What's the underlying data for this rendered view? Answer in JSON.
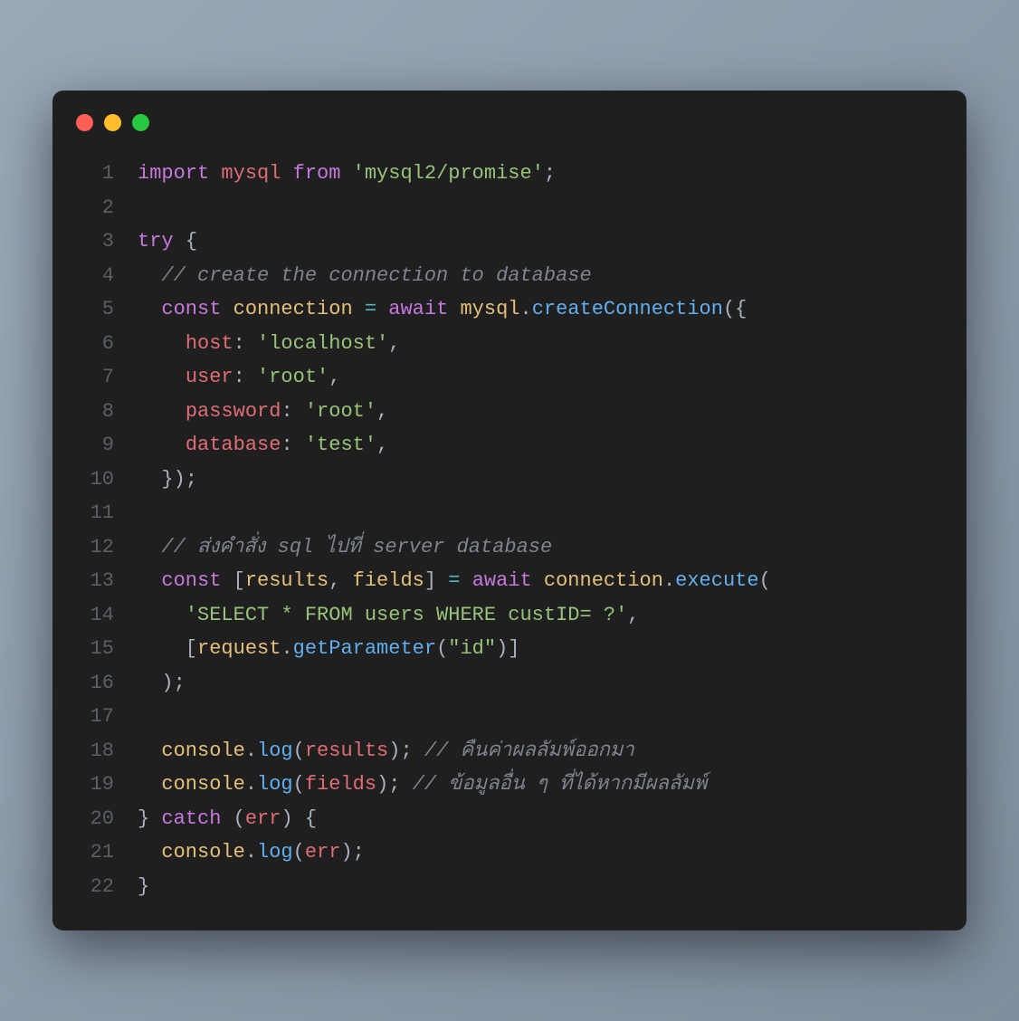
{
  "window": {
    "traffic_lights": {
      "red": "#ff5f56",
      "yellow": "#ffbd2e",
      "green": "#27c93f"
    }
  },
  "code": {
    "lines": [
      {
        "n": "1",
        "tokens": [
          {
            "t": "import",
            "c": "kw"
          },
          {
            "t": " ",
            "c": "txt"
          },
          {
            "t": "mysql",
            "c": "ident"
          },
          {
            "t": " ",
            "c": "txt"
          },
          {
            "t": "from",
            "c": "kw"
          },
          {
            "t": " ",
            "c": "txt"
          },
          {
            "t": "'mysql2/promise'",
            "c": "str"
          },
          {
            "t": ";",
            "c": "punct"
          }
        ]
      },
      {
        "n": "2",
        "tokens": []
      },
      {
        "n": "3",
        "tokens": [
          {
            "t": "try",
            "c": "kw"
          },
          {
            "t": " ",
            "c": "txt"
          },
          {
            "t": "{",
            "c": "punct"
          }
        ]
      },
      {
        "n": "4",
        "tokens": [
          {
            "t": "  ",
            "c": "txt"
          },
          {
            "t": "// create the connection to database",
            "c": "com"
          }
        ]
      },
      {
        "n": "5",
        "tokens": [
          {
            "t": "  ",
            "c": "txt"
          },
          {
            "t": "const",
            "c": "kw"
          },
          {
            "t": " ",
            "c": "txt"
          },
          {
            "t": "connection",
            "c": "obj"
          },
          {
            "t": " ",
            "c": "txt"
          },
          {
            "t": "=",
            "c": "op"
          },
          {
            "t": " ",
            "c": "txt"
          },
          {
            "t": "await",
            "c": "kw"
          },
          {
            "t": " ",
            "c": "txt"
          },
          {
            "t": "mysql",
            "c": "obj"
          },
          {
            "t": ".",
            "c": "punct"
          },
          {
            "t": "createConnection",
            "c": "fn"
          },
          {
            "t": "({",
            "c": "punct"
          }
        ]
      },
      {
        "n": "6",
        "tokens": [
          {
            "t": "    ",
            "c": "txt"
          },
          {
            "t": "host",
            "c": "prop"
          },
          {
            "t": ": ",
            "c": "punct"
          },
          {
            "t": "'localhost'",
            "c": "str"
          },
          {
            "t": ",",
            "c": "punct"
          }
        ]
      },
      {
        "n": "7",
        "tokens": [
          {
            "t": "    ",
            "c": "txt"
          },
          {
            "t": "user",
            "c": "prop"
          },
          {
            "t": ": ",
            "c": "punct"
          },
          {
            "t": "'root'",
            "c": "str"
          },
          {
            "t": ",",
            "c": "punct"
          }
        ]
      },
      {
        "n": "8",
        "tokens": [
          {
            "t": "    ",
            "c": "txt"
          },
          {
            "t": "password",
            "c": "prop"
          },
          {
            "t": ": ",
            "c": "punct"
          },
          {
            "t": "'root'",
            "c": "str"
          },
          {
            "t": ",",
            "c": "punct"
          }
        ]
      },
      {
        "n": "9",
        "tokens": [
          {
            "t": "    ",
            "c": "txt"
          },
          {
            "t": "database",
            "c": "prop"
          },
          {
            "t": ": ",
            "c": "punct"
          },
          {
            "t": "'test'",
            "c": "str"
          },
          {
            "t": ",",
            "c": "punct"
          }
        ]
      },
      {
        "n": "10",
        "tokens": [
          {
            "t": "  ",
            "c": "txt"
          },
          {
            "t": "});",
            "c": "punct"
          }
        ]
      },
      {
        "n": "11",
        "tokens": []
      },
      {
        "n": "12",
        "tokens": [
          {
            "t": "  ",
            "c": "txt"
          },
          {
            "t": "// ส่งคำสั่ง sql ไปที่ server database",
            "c": "com"
          }
        ]
      },
      {
        "n": "13",
        "tokens": [
          {
            "t": "  ",
            "c": "txt"
          },
          {
            "t": "const",
            "c": "kw"
          },
          {
            "t": " [",
            "c": "punct"
          },
          {
            "t": "results",
            "c": "obj"
          },
          {
            "t": ", ",
            "c": "punct"
          },
          {
            "t": "fields",
            "c": "obj"
          },
          {
            "t": "] ",
            "c": "punct"
          },
          {
            "t": "=",
            "c": "op"
          },
          {
            "t": " ",
            "c": "txt"
          },
          {
            "t": "await",
            "c": "kw"
          },
          {
            "t": " ",
            "c": "txt"
          },
          {
            "t": "connection",
            "c": "obj"
          },
          {
            "t": ".",
            "c": "punct"
          },
          {
            "t": "execute",
            "c": "fn"
          },
          {
            "t": "(",
            "c": "punct"
          }
        ]
      },
      {
        "n": "14",
        "tokens": [
          {
            "t": "    ",
            "c": "txt"
          },
          {
            "t": "'SELECT * FROM users WHERE custID= ?'",
            "c": "str"
          },
          {
            "t": ",",
            "c": "punct"
          }
        ]
      },
      {
        "n": "15",
        "tokens": [
          {
            "t": "    [",
            "c": "punct"
          },
          {
            "t": "request",
            "c": "obj"
          },
          {
            "t": ".",
            "c": "punct"
          },
          {
            "t": "getParameter",
            "c": "fn"
          },
          {
            "t": "(",
            "c": "punct"
          },
          {
            "t": "\"id\"",
            "c": "str"
          },
          {
            "t": ")]",
            "c": "punct"
          }
        ]
      },
      {
        "n": "16",
        "tokens": [
          {
            "t": "  ",
            "c": "txt"
          },
          {
            "t": ");",
            "c": "punct"
          }
        ]
      },
      {
        "n": "17",
        "tokens": []
      },
      {
        "n": "18",
        "tokens": [
          {
            "t": "  ",
            "c": "txt"
          },
          {
            "t": "console",
            "c": "obj"
          },
          {
            "t": ".",
            "c": "punct"
          },
          {
            "t": "log",
            "c": "fn"
          },
          {
            "t": "(",
            "c": "punct"
          },
          {
            "t": "results",
            "c": "ident"
          },
          {
            "t": "); ",
            "c": "punct"
          },
          {
            "t": "// คืนค่าผลลัมพ์ออกมา",
            "c": "com"
          }
        ]
      },
      {
        "n": "19",
        "tokens": [
          {
            "t": "  ",
            "c": "txt"
          },
          {
            "t": "console",
            "c": "obj"
          },
          {
            "t": ".",
            "c": "punct"
          },
          {
            "t": "log",
            "c": "fn"
          },
          {
            "t": "(",
            "c": "punct"
          },
          {
            "t": "fields",
            "c": "ident"
          },
          {
            "t": "); ",
            "c": "punct"
          },
          {
            "t": "// ข้อมูลอื่น ๆ ที่ได้หากมีผลลัมพ์",
            "c": "com"
          }
        ]
      },
      {
        "n": "20",
        "tokens": [
          {
            "t": "} ",
            "c": "punct"
          },
          {
            "t": "catch",
            "c": "kw"
          },
          {
            "t": " (",
            "c": "punct"
          },
          {
            "t": "err",
            "c": "ident"
          },
          {
            "t": ") {",
            "c": "punct"
          }
        ]
      },
      {
        "n": "21",
        "tokens": [
          {
            "t": "  ",
            "c": "txt"
          },
          {
            "t": "console",
            "c": "obj"
          },
          {
            "t": ".",
            "c": "punct"
          },
          {
            "t": "log",
            "c": "fn"
          },
          {
            "t": "(",
            "c": "punct"
          },
          {
            "t": "err",
            "c": "ident"
          },
          {
            "t": ");",
            "c": "punct"
          }
        ]
      },
      {
        "n": "22",
        "tokens": [
          {
            "t": "}",
            "c": "punct"
          }
        ]
      }
    ]
  }
}
